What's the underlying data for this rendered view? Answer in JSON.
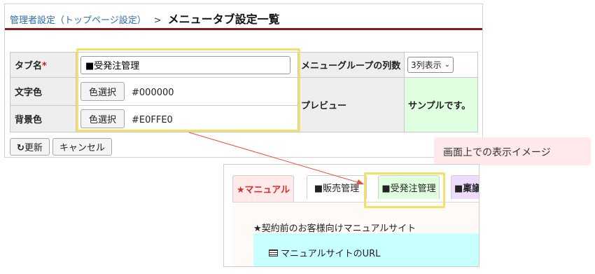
{
  "breadcrumb": {
    "parent": "管理者設定（トップページ設定）",
    "separator": ">",
    "current": "メニュータブ設定一覧"
  },
  "form": {
    "tab_name_label": "タブ名",
    "required_mark": "*",
    "tab_name_value": "■受発注管理",
    "text_color_label": "文字色",
    "text_color_button": "色選択",
    "text_color_value": "#000000",
    "bg_color_label": "背景色",
    "bg_color_button": "色選択",
    "bg_color_value": "#E0FFE0",
    "columns_label": "メニューグループの列数",
    "columns_value": "3列表示",
    "preview_label": "プレビュー",
    "preview_sample": "サンプルです。"
  },
  "actions": {
    "update": "更新",
    "cancel": "キャンセル"
  },
  "callout": {
    "text": "画面上での表示イメージ"
  },
  "preview": {
    "tabs": [
      "★マニュアル",
      "■販売管理",
      "■受発注管理",
      "■稟議"
    ],
    "content_title": "★契約前のお客様向けマニュアルサイト",
    "content_link": "マニュアルサイトのURL"
  },
  "colors": {
    "accent_rule": "#8b1a1a",
    "highlight": "#f2e06b",
    "sample_bg": "#E0FFE0",
    "active_tab": "#d23030",
    "callout_bg": "#ffe9ea"
  }
}
